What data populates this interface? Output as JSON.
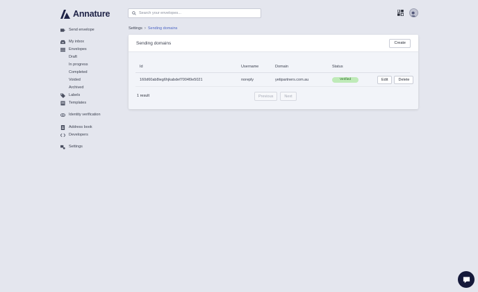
{
  "brand": {
    "name": "Annature",
    "color": "#1e2246"
  },
  "header": {
    "search_placeholder": "Search your envelopes...",
    "icons": {
      "search": "search-icon",
      "apps": "grid-icon",
      "avatar": "user-avatar"
    }
  },
  "sidebar": {
    "send_envelope": "Send envelope",
    "my_inbox": "My inbox",
    "envelopes": "Envelopes",
    "envelope_sub": [
      "Draft",
      "In progress",
      "Completed",
      "Voided",
      "Archived"
    ],
    "labels": "Labels",
    "templates": "Templates",
    "identity_verification": "Identity verification",
    "address_book": "Address book",
    "developers": "Developers",
    "settings": "Settings"
  },
  "breadcrumb": {
    "parent": "Settings",
    "current": "Sending domains"
  },
  "card": {
    "title": "Sending domains",
    "create_label": "Create",
    "columns": {
      "id": "Id",
      "username": "Username",
      "domain": "Domain",
      "status": "Status"
    },
    "rows": [
      {
        "id": "160d60ab8ieg6hjkabdef7004l9e5021",
        "username": "noreply",
        "domain": "yetipartners.com.au",
        "status": "Verified",
        "edit_label": "Edit",
        "delete_label": "Delete"
      }
    ],
    "result_count": "1 result",
    "previous_label": "Previous",
    "next_label": "Next"
  },
  "colors": {
    "background": "#e4e6ee",
    "accent_link": "#4e66c4",
    "status_verified_bg": "#bfeab8",
    "status_verified_text": "#256a23",
    "chat_button": "#15193a"
  }
}
